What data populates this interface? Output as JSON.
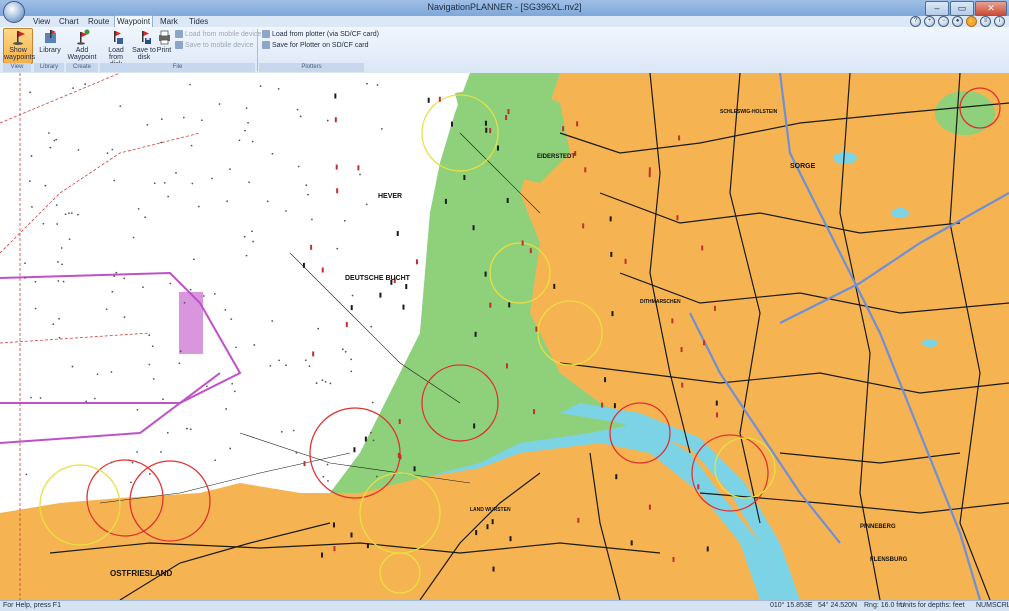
{
  "window": {
    "title": "NavigationPLANNER - [SG396XL.nv2]",
    "min": "–",
    "max": "▭",
    "close": "✕"
  },
  "menu": {
    "tabs": [
      "View",
      "Chart",
      "Route",
      "Waypoint",
      "Mark",
      "Tides"
    ],
    "active": "Waypoint"
  },
  "nav_icons": [
    "help-icon",
    "zoom-in-icon",
    "zoom-out-icon",
    "world-icon",
    "hand-icon",
    "layers-icon",
    "info-icon"
  ],
  "ribbon": {
    "show_waypoints": "Show waypoints",
    "library": "Library",
    "add_waypoint": "Add Waypoint",
    "load_from_disk": "Load from disk",
    "save_to_disk": "Save to disk",
    "print": "Print",
    "load_from_mobile": "Load from mobile device",
    "save_to_mobile": "Save to mobile device",
    "load_from_plotter": "Load from plotter (via SD/CF card)",
    "save_for_plotter": "Save for Plotter on SD/CF card",
    "groups": {
      "view": "View",
      "library": "Library",
      "create": "Create",
      "file": "File",
      "plotters": "Plotters"
    }
  },
  "map": {
    "labels": {
      "hever": "HEVER",
      "deutsche_bucht": "DEUTSCHE BUCHT",
      "eiderstedt": "EIDERSTEDT",
      "ostfriesland": "OSTFRIESLAND",
      "sorge": "SORGE",
      "flensburg": "FLENSBURG",
      "pinneberg": "PINNEBERG",
      "land_wursten": "LAND WURSTEN",
      "schleswig": "SCHLESWIG-HOLSTEIN",
      "dithmarschen": "DITHMARSCHEN"
    },
    "colors": {
      "land": "#f6b351",
      "shallow": "#7dd3e6",
      "green": "#8fd07a",
      "sea": "#ffffff",
      "road": "#1a1a1a",
      "blue_road": "#6f8fd6",
      "magenta": "#c050c8"
    }
  },
  "status": {
    "help": "For Help, press F1",
    "lon": "010° 15.853E",
    "lat": "54° 24.520N",
    "rng": "Rng: 16.0 fm",
    "depth_units": "Units for depths: feet",
    "num": "NUM",
    "scrl": "SCRL"
  }
}
